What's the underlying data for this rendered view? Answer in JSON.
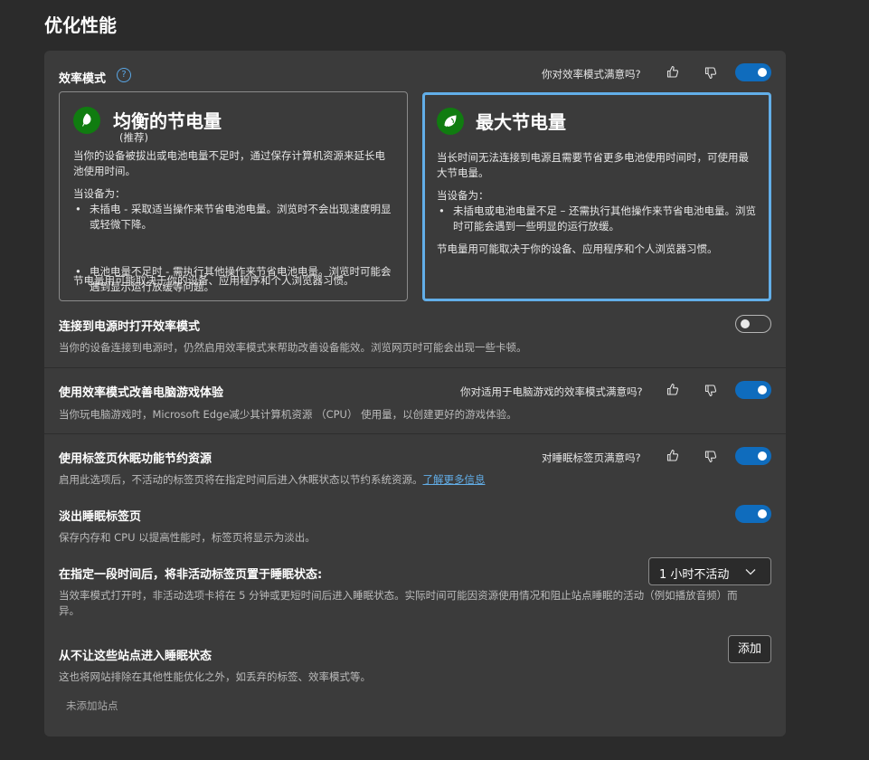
{
  "page": {
    "title": "优化性能"
  },
  "efficiency": {
    "label": "效率模式",
    "help_glyph": "?",
    "feedback_question": "你对效率模式满意吗?",
    "enabled": true
  },
  "cards": {
    "balanced": {
      "title": "均衡的节电量",
      "subtitle": "(推荐)",
      "desc": "当你的设备被拔出或电池电量不足时，通过保存计算机资源来延长电池使用时间。",
      "when_label": "当设备为：",
      "bullets": [
        "未插电 - 采取适当操作来节省电池电量。浏览时不会出现速度明显或轻微下降。",
        "电池电量不足时 - 需执行其他操作来节省电池电量。浏览时可能会遇到显示运行放缓等问题。"
      ],
      "footer": "节电量用可能取决于你的设备、应用程序和个人浏览器习惯。"
    },
    "maximum": {
      "title": "最大节电量",
      "desc": "当长时间无法连接到电源且需要节省更多电池使用时间时，可使用最大节电量。",
      "when_label": "当设备为：",
      "bullets": [
        "未插电或电池电量不足 – 还需执行其他操作来节省电池电量。浏览时可能会遇到一些明显的运行放缓。"
      ],
      "footer": "节电量用可能取决于你的设备、应用程序和个人浏览器习惯。"
    },
    "bullet_char": "•"
  },
  "plugged": {
    "title": "连接到电源时打开效率模式",
    "desc": "当你的设备连接到电源时，仍然启用效率模式来帮助改善设备能效。浏览网页时可能会出现一些卡顿。",
    "enabled": false
  },
  "gaming": {
    "title": "使用效率模式改善电脑游戏体验",
    "feedback_question": "你对适用于电脑游戏的效率模式满意吗?",
    "desc": "当你玩电脑游戏时，Microsoft Edge减少其计算机资源 （CPU） 使用量，以创建更好的游戏体验。",
    "enabled": true
  },
  "sleeping": {
    "title": "使用标签页休眠功能节约资源",
    "feedback_question": "对睡眠标签页满意吗?",
    "desc": "启用此选项后，不活动的标签页将在指定时间后进入休眠状态以节约系统资源。",
    "link": "了解更多信息",
    "enabled": true
  },
  "fade": {
    "title": "淡出睡眠标签页",
    "desc": "保存内存和 CPU 以提高性能时，标签页将显示为淡出。",
    "enabled": true
  },
  "timeout": {
    "title": "在指定一段时间后，将非活动标签页置于睡眠状态:",
    "selected": "1 小时不活动",
    "desc_line1": "当效率模式打开时，非活动选项卡将在 5 分钟或更短时间后进入睡眠状态。实际时间可能因资源使用情况和阻止站点睡眠的活动（例如播放音频）而",
    "desc_line2": "异。"
  },
  "never_sleep": {
    "title": "从不让这些站点进入睡眠状态",
    "desc": "这也将网站排除在其他性能优化之外，如丢弃的标签、效率模式等。",
    "add_button": "添加",
    "empty_text": "未添加站点"
  },
  "colors": {
    "background": "#2b2b2b",
    "panel": "#3b3b3b",
    "accent": "#0f6cbd",
    "selected_border": "#62aee8",
    "leaf_green": "#107c10"
  },
  "icons": {
    "help": "help-circle-icon",
    "like": "thumbs-up-icon",
    "dislike": "thumbs-down-icon",
    "leaf": "leaf-icon",
    "chevron": "chevron-down-icon"
  }
}
